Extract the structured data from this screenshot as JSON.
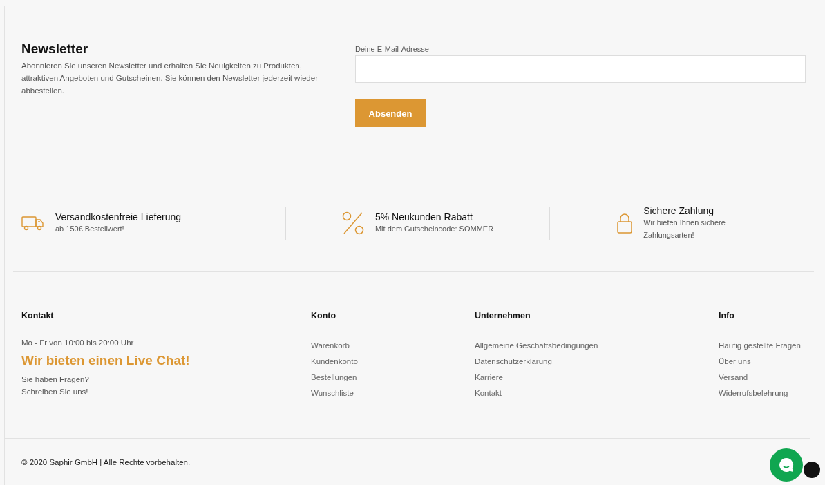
{
  "newsletter": {
    "title": "Newsletter",
    "text": "Abonnieren Sie unseren Newsletter und erhalten Sie Neuigkeiten zu Produkten, attraktiven Angeboten und Gutscheinen. Sie können den Newsletter jederzeit wieder abbestellen.",
    "email_label": "Deine E-Mail-Adresse",
    "button": "Absenden"
  },
  "features": [
    {
      "kind": "truck",
      "title": "Versandkostenfreie Lieferung",
      "text": "ab 150€ Bestellwert!"
    },
    {
      "kind": "percent",
      "title": "5% Neukunden Rabatt",
      "text": "Mit dem Gutscheincode: SOMMER"
    },
    {
      "kind": "lock",
      "title": "Sichere Zahlung",
      "text": "Wir bieten Ihnen sichere Zahlungsarten!"
    }
  ],
  "contact": {
    "title": "Kontakt",
    "hours": "Mo - Fr von 10:00 bis 20:00 Uhr",
    "headline": "Wir bieten einen Live Chat!",
    "lines": [
      "Sie haben Fragen?",
      "Schreiben Sie uns!"
    ]
  },
  "columns": [
    {
      "title": "Konto",
      "links": [
        "Warenkorb",
        "Kundenkonto",
        "Bestellungen",
        "Wunschliste"
      ]
    },
    {
      "title": "Unternehmen",
      "links": [
        "Allgemeine Geschäftsbedingungen",
        "Datenschutzerklärung",
        "Karriere",
        "Kontakt"
      ]
    },
    {
      "title": "Info",
      "links": [
        "Häufig gestellte Fragen",
        "Über uns",
        "Versand",
        "Widerrufsbelehrung"
      ]
    }
  ],
  "copyright": "© 2020 Saphir GmbH | Alle Rechte vorbehalten."
}
